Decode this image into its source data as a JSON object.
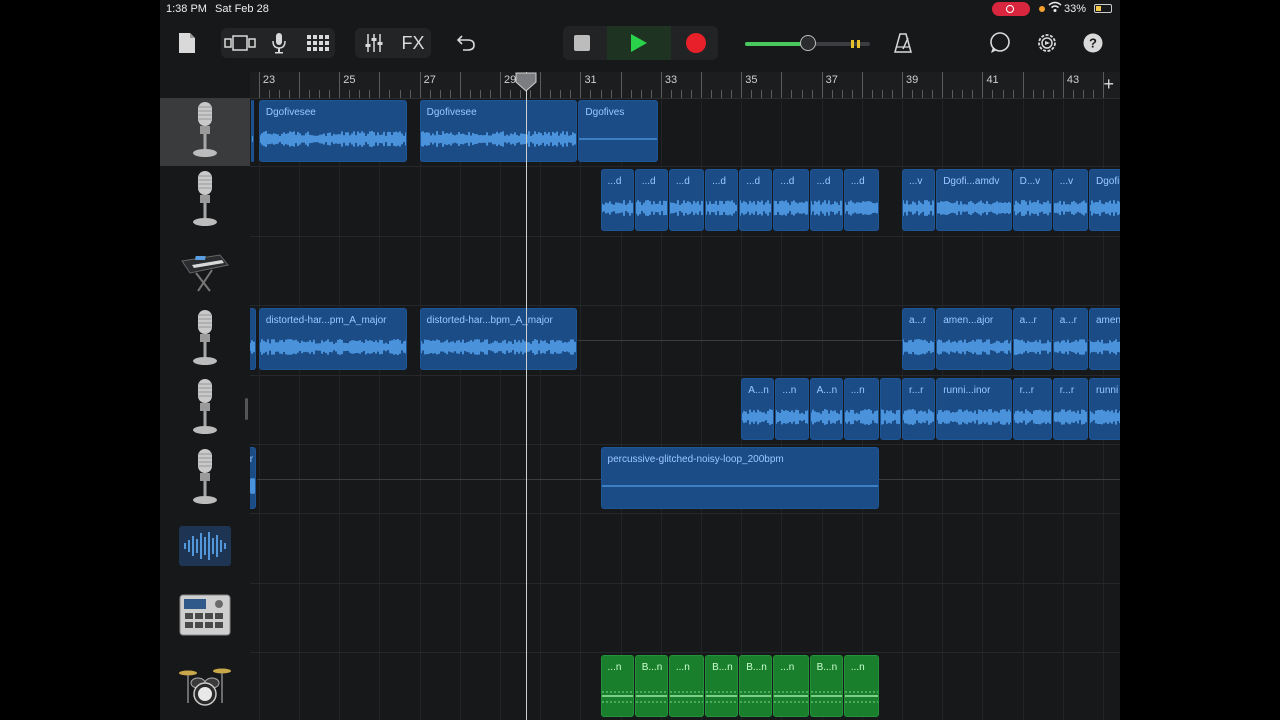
{
  "status_bar": {
    "time": "1:38 PM",
    "date": "Sat Feb 28",
    "battery": "33%"
  },
  "toolbar": {
    "fx_label": "FX"
  },
  "colors": {
    "audio_region": "#1b4c86",
    "drum_region": "#1a7f2c",
    "play": "#2ad14a",
    "record": "#e8202a"
  },
  "volume": {
    "level": 0.5
  },
  "ruler": {
    "bars": [
      "23",
      "25",
      "27",
      "29",
      "31",
      "33",
      "35",
      "37",
      "39",
      "41",
      "43"
    ]
  },
  "tracks": [
    {
      "icon": "microphone-icon"
    },
    {
      "icon": "microphone-icon"
    },
    {
      "icon": "keyboard-icon"
    },
    {
      "icon": "microphone-icon"
    },
    {
      "icon": "microphone-icon"
    },
    {
      "icon": "microphone-icon"
    },
    {
      "icon": "audio-waveform-icon"
    },
    {
      "icon": "beat-sequencer-icon"
    },
    {
      "icon": "drum-kit-icon"
    }
  ],
  "regions": [
    [
      {
        "name": "",
        "start": 22.8,
        "end": 22.9
      },
      {
        "name": "Dgofivesee",
        "start": 23.0,
        "end": 26.7
      },
      {
        "name": "Dgofivesee",
        "start": 27.0,
        "end": 30.95
      },
      {
        "name": "Dgofives",
        "start": 30.95,
        "end": 32.95,
        "quiet": true
      }
    ],
    [
      {
        "name": "...d",
        "start": 31.5,
        "end": 32.35
      },
      {
        "name": "...d",
        "start": 32.35,
        "end": 33.2
      },
      {
        "name": "...d",
        "start": 33.2,
        "end": 34.1
      },
      {
        "name": "...d",
        "start": 34.1,
        "end": 34.95
      },
      {
        "name": "...d",
        "start": 34.95,
        "end": 35.8
      },
      {
        "name": "...d",
        "start": 35.8,
        "end": 36.7
      },
      {
        "name": "...d",
        "start": 36.7,
        "end": 37.55
      },
      {
        "name": "...d",
        "start": 37.55,
        "end": 38.45
      },
      {
        "name": "...v",
        "start": 39.0,
        "end": 39.85
      },
      {
        "name": "Dgofi...amdv",
        "start": 39.85,
        "end": 41.75
      },
      {
        "name": "D...v",
        "start": 41.75,
        "end": 42.75
      },
      {
        "name": "...v",
        "start": 42.75,
        "end": 43.65
      },
      {
        "name": "Dgofi",
        "start": 43.65,
        "end": 45.0
      }
    ],
    [],
    [
      {
        "name": "",
        "start": 22.6,
        "end": 22.95
      },
      {
        "name": "distorted-har...pm_A_major",
        "start": 23.0,
        "end": 26.7
      },
      {
        "name": "distorted-har...bpm_A_major",
        "start": 27.0,
        "end": 30.95
      },
      {
        "name": "a...r",
        "start": 39.0,
        "end": 39.85
      },
      {
        "name": "amen...ajor",
        "start": 39.85,
        "end": 41.75
      },
      {
        "name": "a...r",
        "start": 41.75,
        "end": 42.75
      },
      {
        "name": "a...r",
        "start": 42.75,
        "end": 43.65
      },
      {
        "name": "amen",
        "start": 43.65,
        "end": 45.0
      }
    ],
    [
      {
        "name": "A...n",
        "start": 35.0,
        "end": 35.85
      },
      {
        "name": "...n",
        "start": 35.85,
        "end": 36.7
      },
      {
        "name": "A...n",
        "start": 36.7,
        "end": 37.55
      },
      {
        "name": "...n",
        "start": 37.55,
        "end": 38.45
      },
      {
        "name": "",
        "start": 38.45,
        "end": 39.0
      },
      {
        "name": "r...r",
        "start": 39.0,
        "end": 39.85
      },
      {
        "name": "runni...inor",
        "start": 39.85,
        "end": 41.75
      },
      {
        "name": "r...r",
        "start": 41.75,
        "end": 42.75
      },
      {
        "name": "r...r",
        "start": 42.75,
        "end": 43.65
      },
      {
        "name": "runni",
        "start": 43.65,
        "end": 45.0
      }
    ],
    [
      {
        "name": "r",
        "start": 22.6,
        "end": 22.95
      },
      {
        "name": "percussive-glitched-noisy-loop_200bpm",
        "start": 31.5,
        "end": 38.45,
        "quiet": true
      }
    ],
    [],
    [],
    [
      {
        "name": "...n",
        "start": 31.5,
        "end": 32.35,
        "green": true
      },
      {
        "name": "B...n",
        "start": 32.35,
        "end": 33.2,
        "green": true
      },
      {
        "name": "...n",
        "start": 33.2,
        "end": 34.1,
        "green": true
      },
      {
        "name": "B...n",
        "start": 34.1,
        "end": 34.95,
        "green": true
      },
      {
        "name": "B...n",
        "start": 34.95,
        "end": 35.8,
        "green": true
      },
      {
        "name": "...n",
        "start": 35.8,
        "end": 36.7,
        "green": true
      },
      {
        "name": "B...n",
        "start": 36.7,
        "end": 37.55,
        "green": true
      },
      {
        "name": "...n",
        "start": 37.55,
        "end": 38.45,
        "green": true
      }
    ]
  ],
  "playhead": {
    "bar": 29.65
  }
}
